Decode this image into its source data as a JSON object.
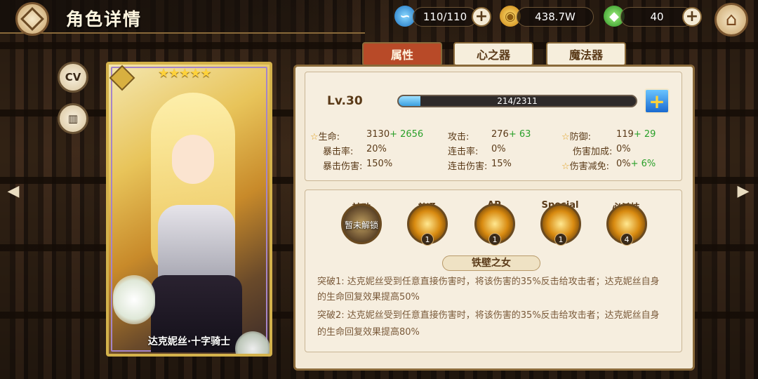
{
  "header": {
    "title": "角色详情"
  },
  "resources": [
    {
      "icon": "stamina-icon",
      "value": "110/110",
      "color": "#3aa0e0"
    },
    {
      "icon": "gold-coin-icon",
      "value": "438.7W",
      "color": "#f0b020"
    },
    {
      "icon": "green-gem-icon",
      "value": "40",
      "color": "#4ac040"
    }
  ],
  "side": {
    "cv_label": "CV"
  },
  "card": {
    "stars": "★★★★★",
    "name": "达克妮丝·十字骑士"
  },
  "tabs": [
    {
      "label": "属性",
      "active": true
    },
    {
      "label": "心之器",
      "active": false
    },
    {
      "label": "魔法器",
      "active": false
    }
  ],
  "level": {
    "label": "Lv.30",
    "exp_text": "214/2311",
    "progress": 0.093
  },
  "stats": [
    {
      "label": "生命:",
      "value": "3130",
      "bonus": "+ 2656",
      "star": true
    },
    {
      "label": "攻击:",
      "value": "276",
      "bonus": "+ 63",
      "star": false
    },
    {
      "label": "防御:",
      "value": "119",
      "bonus": "+ 29",
      "star": true
    },
    {
      "label": "暴击率:",
      "value": "20%",
      "bonus": "",
      "star": false
    },
    {
      "label": "连击率:",
      "value": "0%",
      "bonus": "",
      "star": false
    },
    {
      "label": "伤害加成:",
      "value": "0%",
      "bonus": "",
      "star": false
    },
    {
      "label": "暴击伤害:",
      "value": "150%",
      "bonus": "",
      "star": false
    },
    {
      "label": "连击伤害:",
      "value": "15%",
      "bonus": "",
      "star": false
    },
    {
      "label": "伤害减免:",
      "value": "0%",
      "bonus": "+ 6%",
      "star": true
    }
  ],
  "skills": [
    {
      "label": "被动",
      "locked_text": "暂未解锁",
      "level": ""
    },
    {
      "label": "普通",
      "locked_text": "",
      "level": "1"
    },
    {
      "label": "AP",
      "locked_text": "",
      "level": "1"
    },
    {
      "label": "Special",
      "locked_text": "",
      "level": "1"
    },
    {
      "label": "必杀技",
      "locked_text": "",
      "level": "4"
    }
  ],
  "skill_name": "铁壁之女",
  "skill_desc": [
    "突破1: 达克妮丝受到任意直接伤害时，将该伤害的35%反击给攻击者；达克妮丝自身",
    "的生命回复效果提高50%",
    "突破2: 达克妮丝受到任意直接伤害时，将该伤害的35%反击给攻击者；达克妮丝自身",
    "的生命回复效果提高80%"
  ]
}
